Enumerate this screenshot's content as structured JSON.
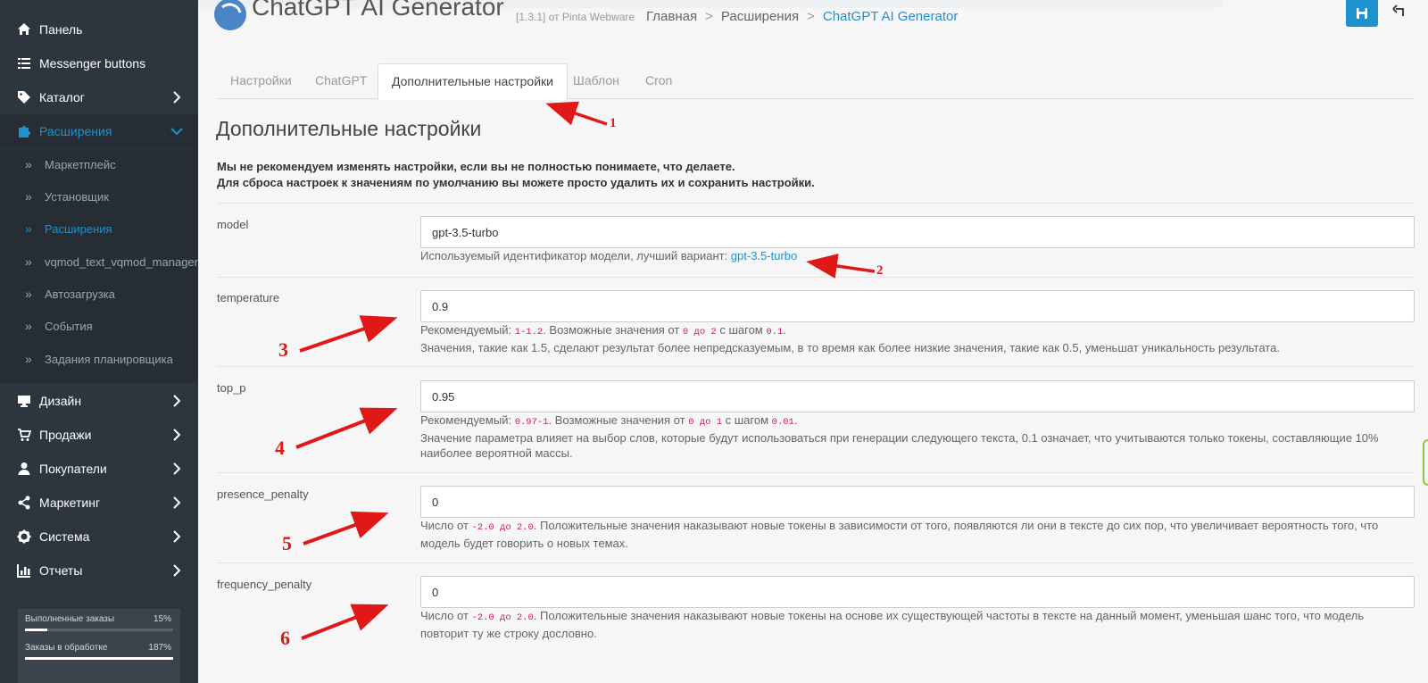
{
  "sidebar": {
    "items": [
      {
        "label": "Панель",
        "icon": "home-icon"
      },
      {
        "label": "Messenger buttons",
        "icon": "list-icon"
      },
      {
        "label": "Каталог",
        "icon": "tag-icon"
      },
      {
        "label": "Расширения",
        "icon": "puzzle-icon"
      },
      {
        "label": "Дизайн",
        "icon": "monitor-icon"
      },
      {
        "label": "Продажи",
        "icon": "cart-icon"
      },
      {
        "label": "Покупатели",
        "icon": "user-icon"
      },
      {
        "label": "Маркетинг",
        "icon": "share-icon"
      },
      {
        "label": "Система",
        "icon": "gear-icon"
      },
      {
        "label": "Отчеты",
        "icon": "bar-chart-icon"
      }
    ],
    "submenu": [
      "Маркетплейс",
      "Установщик",
      "Расширения",
      "vqmod_text_vqmod_manager",
      "Автозагрузка",
      "События",
      "Задания планировщика"
    ],
    "stats": [
      {
        "label": "Выполненные заказы",
        "percent": "15%",
        "fill": 0.15
      },
      {
        "label": "Заказы в обработке",
        "percent": "187%",
        "fill": 1.0
      }
    ]
  },
  "header": {
    "title": "ChatGPT AI Generator",
    "version": "[1.3.1] от Pinta Webware",
    "breadcrumbs": [
      "Главная",
      "Расширения",
      "ChatGPT AI Generator"
    ]
  },
  "tabs": [
    "Настройки",
    "ChatGPT",
    "Дополнительные настройки",
    "Шаблон",
    "Cron"
  ],
  "section": {
    "title": "Дополнительные настройки",
    "warning_line1": "Мы не рекомендуем изменять настройки, если вы не полностью понимаете, что делаете.",
    "warning_line2": "Для сброса настроек к значениям по умолчанию вы можете просто удалить их и сохранить настройки."
  },
  "fields": {
    "model": {
      "label": "model",
      "value": "gpt-3.5-turbo",
      "help_prefix": "Используемый идентификатор модели, лучший вариант: ",
      "help_link": "gpt-3.5-turbo"
    },
    "temperature": {
      "label": "temperature",
      "value": "0.9",
      "help_1": "Рекомендуемый: ",
      "code_1": "1-1.2",
      "help_2": ". Возможные значения от ",
      "code_2": "0 до 2",
      "help_3": " с шагом ",
      "code_3": "0.1",
      "help_4": ".",
      "help_line2": "Значения, такие как 1.5, сделают результат более непредсказуемым, в то время как более низкие значения, такие как 0.5, уменьшат уникальность результата."
    },
    "top_p": {
      "label": "top_p",
      "value": "0.95",
      "help_1": "Рекомендуемый: ",
      "code_1": "0.97-1",
      "help_2": ". Возможные значения от ",
      "code_2": "0 до 1",
      "help_3": " с шагом ",
      "code_3": "0.01",
      "help_4": ".",
      "help_line2": "Значение параметра влияет на выбор слов, которые будут использоваться при генерации следующего текста, 0.1 означает, что учитываются только токены, составляющие 10% наиболее вероятной массы."
    },
    "presence_penalty": {
      "label": "presence_penalty",
      "value": "0",
      "help_1": "Число от ",
      "code_1": "-2.0 до 2.0",
      "help_2": ". Положительные значения наказывают новые токены в зависимости от того, появляются ли они в тексте до сих пор, что увеличивает вероятность того, что модель будет говорить о новых темах."
    },
    "frequency_penalty": {
      "label": "frequency_penalty",
      "value": "0",
      "help_1": "Число от ",
      "code_1": "-2.0 до 2.0",
      "help_2": ". Положительные значения наказывают новые токены на основе их существующей частоты в тексте на данный момент, уменьшая шанс того, что модель повторит ту же строку дословно."
    }
  },
  "annotations": [
    "1",
    "2",
    "3",
    "4",
    "5",
    "6"
  ],
  "colors": {
    "accent": "#1e91cf",
    "sidebar": "#2d353e",
    "annotation": "#e01818"
  }
}
